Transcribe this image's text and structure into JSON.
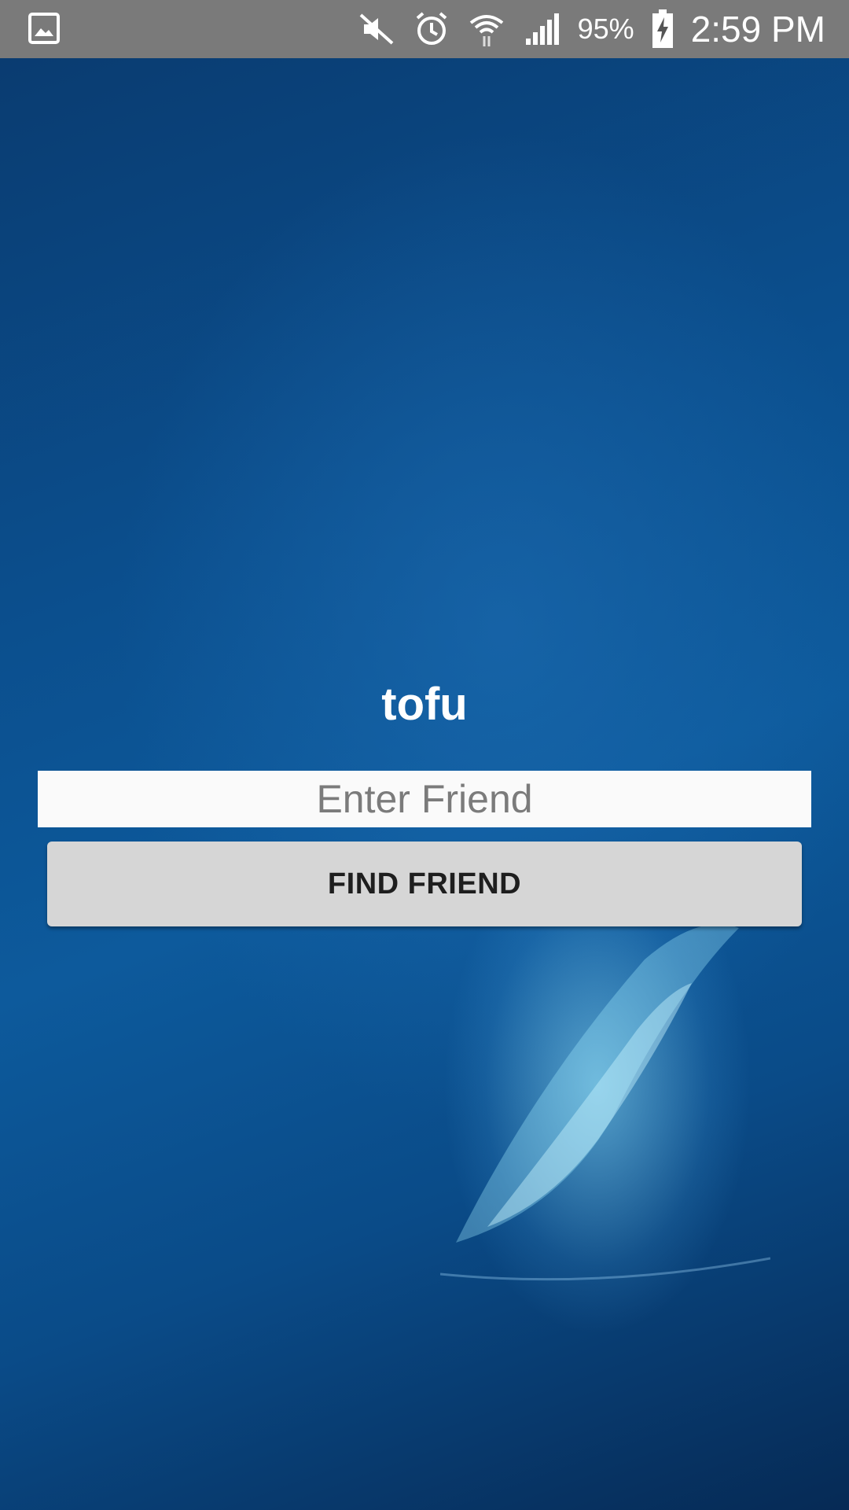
{
  "status_bar": {
    "battery_percent": "95%",
    "time": "2:59 PM",
    "icons": [
      "image-notification-icon",
      "mute-icon",
      "alarm-icon",
      "wifi-icon",
      "cellular-signal-icon",
      "battery-charging-icon"
    ],
    "background_color": "#7a7a7a"
  },
  "app": {
    "title": "tofu",
    "friend_input": {
      "value": "",
      "placeholder": "Enter Friend"
    },
    "find_button_label": "FIND FRIEND"
  },
  "colors": {
    "background_primary": "#0b4f8e",
    "background_dark": "#062a55",
    "input_background": "#fafafa",
    "button_background": "#d6d6d6"
  }
}
